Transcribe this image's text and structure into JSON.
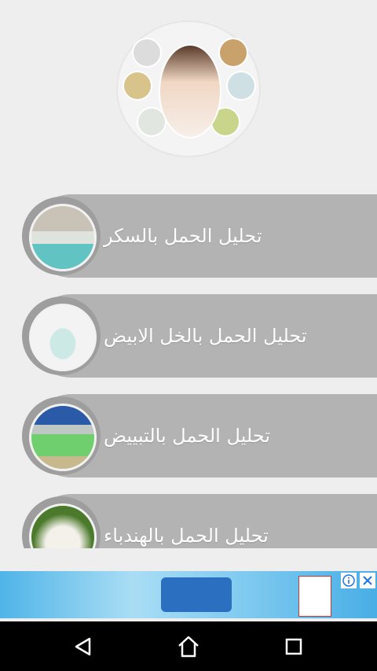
{
  "items": [
    {
      "label": "تحليل الحمل بالسكر"
    },
    {
      "label": "تحليل الحمل بالخل الابيض"
    },
    {
      "label": "تحليل الحمل بالتبييض"
    },
    {
      "label": "تحليل الحمل بالهندباء"
    }
  ],
  "colors": {
    "background": "#eeeeee",
    "item_bar": "#b3b3b3",
    "item_label": "#ffffff",
    "nav_bar": "#000000"
  },
  "ad": {
    "info_icon": "info-icon",
    "close_icon": "close-icon"
  },
  "nav": {
    "back_icon": "back-icon",
    "home_icon": "home-icon",
    "recents_icon": "recents-icon"
  }
}
